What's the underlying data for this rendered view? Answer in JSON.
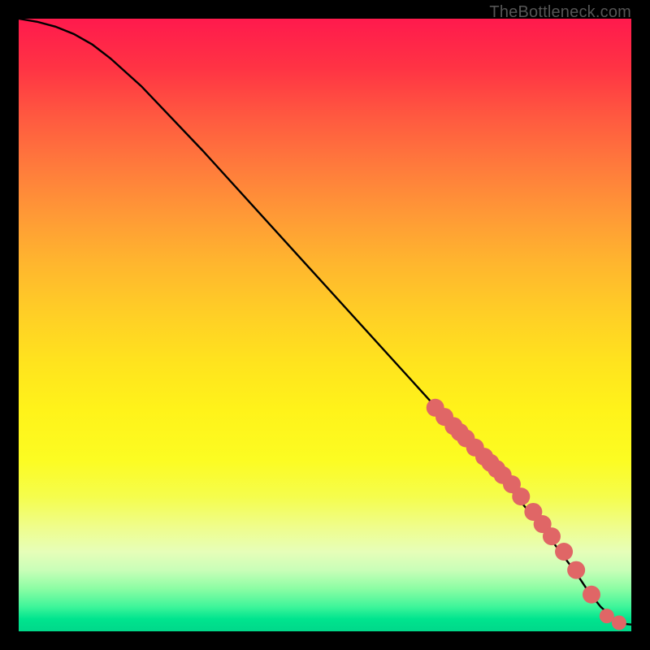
{
  "watermark": "TheBottleneck.com",
  "chart_data": {
    "type": "line",
    "title": "",
    "xlabel": "",
    "ylabel": "",
    "xlim": [
      0,
      100
    ],
    "ylim": [
      0,
      100
    ],
    "grid": false,
    "legend": false,
    "series": [
      {
        "name": "curve",
        "type": "line",
        "color": "#000000",
        "x": [
          0,
          3,
          6,
          9,
          12,
          15,
          20,
          30,
          40,
          50,
          60,
          70,
          80,
          85,
          88,
          91,
          93,
          95,
          97,
          98,
          99,
          100
        ],
        "y": [
          100,
          99.5,
          98.7,
          97.5,
          95.8,
          93.5,
          89.0,
          78.5,
          67.5,
          56.5,
          45.5,
          34.5,
          23.5,
          17.5,
          13.5,
          9.5,
          6.5,
          4.0,
          2.2,
          1.5,
          1.2,
          1.1
        ]
      },
      {
        "name": "points",
        "type": "scatter",
        "color": "#e06666",
        "x": [
          68,
          69.5,
          71,
          72,
          73,
          74.5,
          76,
          77,
          78,
          79,
          80.5,
          82,
          84,
          85.5,
          87,
          89,
          91,
          93.5,
          96,
          98
        ],
        "y": [
          36.5,
          35.0,
          33.5,
          32.5,
          31.5,
          30.0,
          28.5,
          27.5,
          26.5,
          25.5,
          24.0,
          22.0,
          19.5,
          17.5,
          15.5,
          13.0,
          10.0,
          6.0,
          2.5,
          1.4
        ],
        "radius_px": [
          11,
          11,
          11,
          11,
          11,
          11,
          11,
          11,
          11,
          11,
          11,
          11,
          11,
          11,
          11,
          11,
          11,
          11,
          9,
          9
        ]
      }
    ]
  }
}
